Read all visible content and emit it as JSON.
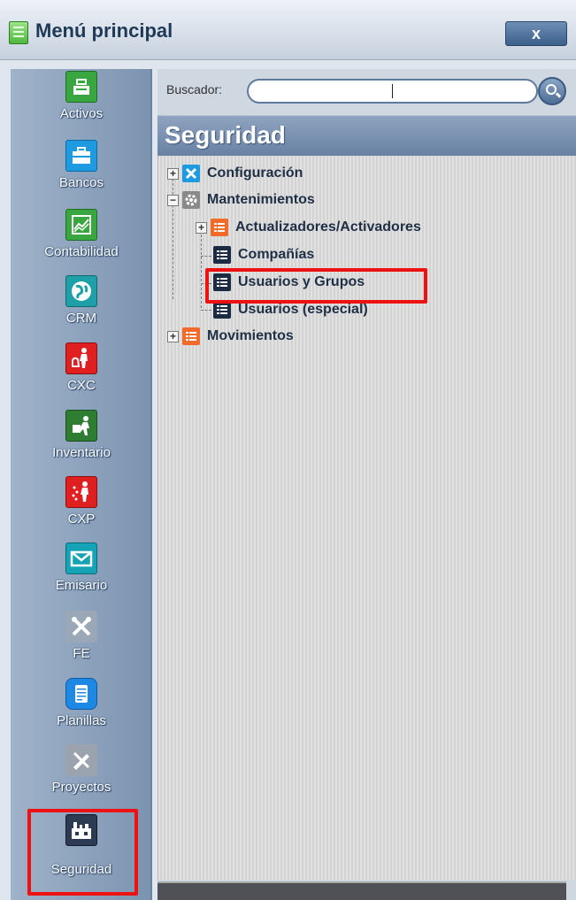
{
  "window": {
    "title": "Menú principal",
    "close_label": "x"
  },
  "sidebar": {
    "items": [
      {
        "label": "Activos",
        "icon": "cash-register-icon",
        "color": "#3aa640"
      },
      {
        "label": "Bancos",
        "icon": "briefcase-icon",
        "color": "#1e9be0"
      },
      {
        "label": "Contabilidad",
        "icon": "chart-icon",
        "color": "#3aa640"
      },
      {
        "label": "CRM",
        "icon": "globe-icon",
        "color": "#1fa0a8"
      },
      {
        "label": "CXC",
        "icon": "person-money-icon",
        "color": "#e02020"
      },
      {
        "label": "Inventario",
        "icon": "person-box-icon",
        "color": "#2e7d32"
      },
      {
        "label": "CXP",
        "icon": "person-coins-icon",
        "color": "#e02020"
      },
      {
        "label": "Emisario",
        "icon": "envelope-icon",
        "color": "#15a3b5"
      },
      {
        "label": "FE",
        "icon": "tools-icon",
        "color": "#6e7a89"
      },
      {
        "label": "Planillas",
        "icon": "document-icon",
        "color": "#1e88e5"
      },
      {
        "label": "Proyectos",
        "icon": "ruler-pencil-icon",
        "color": "#8a93a0"
      },
      {
        "label": "Seguridad",
        "icon": "factory-icon",
        "color": "#2c3a52"
      }
    ],
    "active": "Seguridad"
  },
  "search": {
    "label": "Buscador:",
    "value": "",
    "placeholder": ""
  },
  "section": {
    "title": "Seguridad"
  },
  "tree": {
    "nodes": [
      {
        "label": "Configuración",
        "icon": "tools-icon",
        "level": 0,
        "expander": "+",
        "color": "#1e9be0"
      },
      {
        "label": "Mantenimientos",
        "icon": "gear-icon",
        "level": 0,
        "expander": "−",
        "color": "#8a8a8a"
      },
      {
        "label": "Actualizadores/Activadores",
        "icon": "list-icon",
        "level": 1,
        "expander": "+",
        "color": "#f26b2a"
      },
      {
        "label": "Compañías",
        "icon": "list-icon",
        "level": 1,
        "expander": "",
        "color": "#1c2b44"
      },
      {
        "label": "Usuarios y Grupos",
        "icon": "list-icon",
        "level": 1,
        "expander": "",
        "color": "#1c2b44",
        "highlighted": true
      },
      {
        "label": "Usuarios (especial)",
        "icon": "list-icon",
        "level": 1,
        "expander": "",
        "color": "#1c2b44"
      },
      {
        "label": "Movimientos",
        "icon": "list-icon",
        "level": 0,
        "expander": "+",
        "color": "#f26b2a"
      }
    ]
  },
  "colors": {
    "highlight": "#ee1111",
    "header_bg": "#6982a4"
  }
}
